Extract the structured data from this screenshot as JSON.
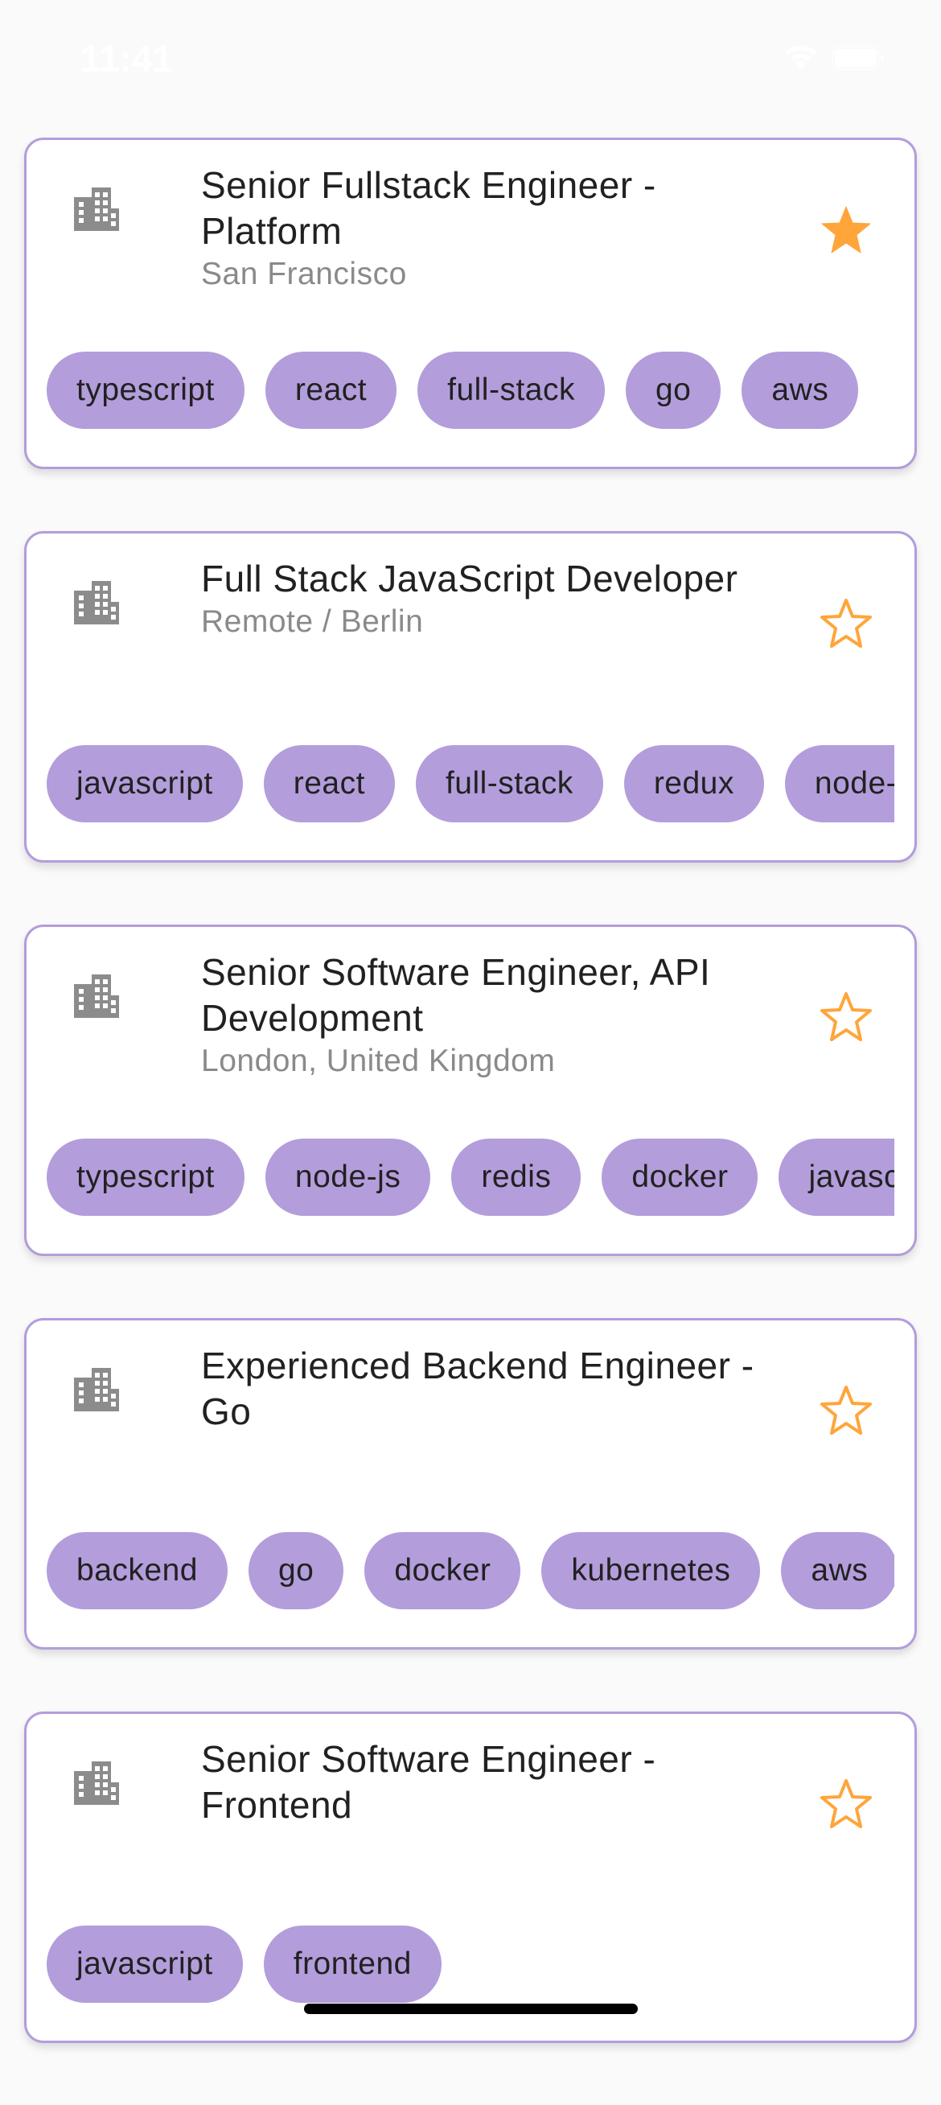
{
  "status_bar": {
    "time": "11:41",
    "icons": [
      "wifi-icon",
      "battery-icon"
    ]
  },
  "colors": {
    "accent": "#b39ddb",
    "star": "#ffa53a",
    "background": "#fafafa",
    "icon_gray": "#8c8c8c"
  },
  "jobs": [
    {
      "title": "Senior Fullstack Engineer - Platform",
      "location": "San Francisco",
      "favorite": true,
      "icon": "building-icon",
      "tags": [
        "typescript",
        "react",
        "full-stack",
        "go",
        "aws"
      ]
    },
    {
      "title": "Full Stack JavaScript Developer",
      "location": "Remote / Berlin",
      "favorite": false,
      "icon": "building-icon",
      "tags": [
        "javascript",
        "react",
        "full-stack",
        "redux",
        "node-js"
      ]
    },
    {
      "title": "Senior Software Engineer, API Development",
      "location": "London, United Kingdom",
      "favorite": false,
      "icon": "building-icon",
      "tags": [
        "typescript",
        "node-js",
        "redis",
        "docker",
        "javascript"
      ]
    },
    {
      "title": "Experienced Backend Engineer - Go",
      "location": "",
      "favorite": false,
      "icon": "building-icon",
      "tags": [
        "backend",
        "go",
        "docker",
        "kubernetes",
        "aws"
      ]
    },
    {
      "title": "Senior Software Engineer - Frontend",
      "location": "",
      "favorite": false,
      "icon": "building-icon",
      "tags": [
        "javascript",
        "frontend"
      ]
    }
  ]
}
